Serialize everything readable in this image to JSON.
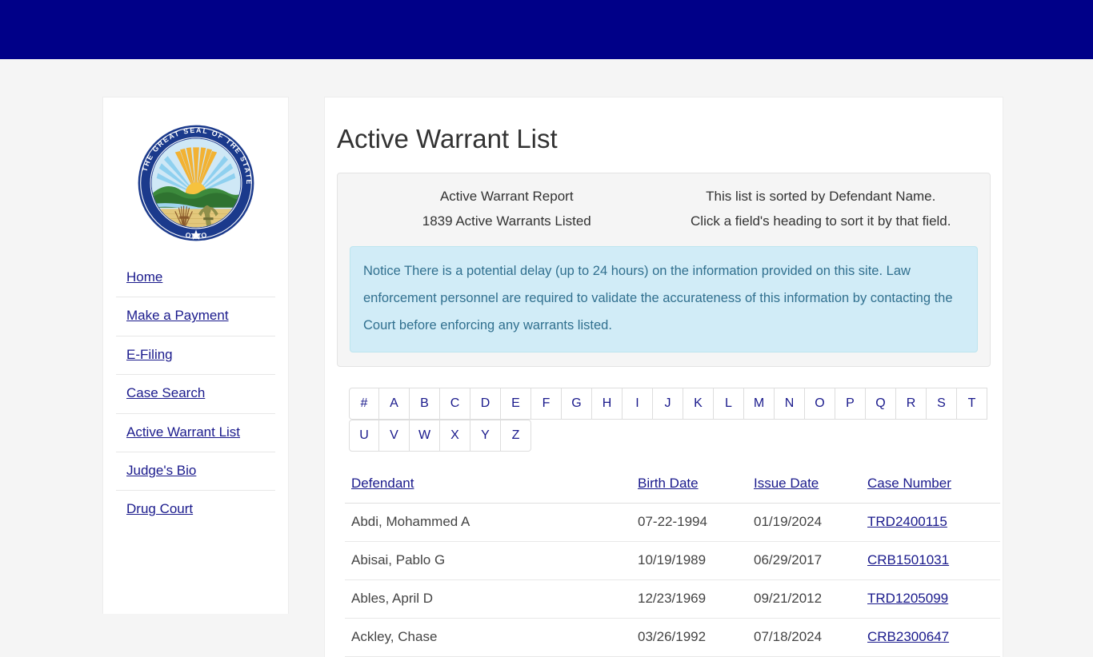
{
  "header": {
    "bar_color": "#000088"
  },
  "sidebar": {
    "seal": {
      "icon": "ohio-state-seal",
      "ring_text_top": "THE GREAT SEAL OF",
      "ring_text_bottom": "THE STATE OF OHIO"
    },
    "items": [
      {
        "label": "Home"
      },
      {
        "label": "Make a Payment"
      },
      {
        "label": "E-Filing"
      },
      {
        "label": "Case Search"
      },
      {
        "label": "Active Warrant List"
      },
      {
        "label": "Judge's Bio"
      },
      {
        "label": "Drug Court"
      }
    ]
  },
  "main": {
    "title": "Active Warrant List",
    "info": {
      "left": [
        "Active Warrant Report",
        "1839 Active Warrants Listed"
      ],
      "right": [
        "This list is sorted by Defendant Name.",
        "Click a field's heading to sort it by that field."
      ],
      "alert": "Notice There is a potential delay (up to 24 hours) on the information provided on this site. Law enforcement personnel are required to validate the accurateness of this information by contacting the Court before enforcing any warrants listed.",
      "alert_bg": "#d1ecf7",
      "alert_text_color": "#31708f"
    },
    "pagination": {
      "row1": [
        "#",
        "A",
        "B",
        "C",
        "D",
        "E",
        "F",
        "G",
        "H",
        "I",
        "J",
        "K",
        "L",
        "M",
        "N",
        "O",
        "P",
        "Q",
        "R",
        "S",
        "T"
      ],
      "row2": [
        "U",
        "V",
        "W",
        "X",
        "Y",
        "Z"
      ]
    },
    "table": {
      "columns": [
        "Defendant",
        "Birth Date",
        "Issue Date",
        "Case Number"
      ],
      "rows": [
        {
          "defendant": "Abdi, Mohammed A",
          "birth_date": "07-22-1994",
          "issue_date": "01/19/2024",
          "case_number": "TRD2400115"
        },
        {
          "defendant": "Abisai, Pablo G",
          "birth_date": "10/19/1989",
          "issue_date": "06/29/2017",
          "case_number": "CRB1501031"
        },
        {
          "defendant": "Ables, April D",
          "birth_date": "12/23/1969",
          "issue_date": "09/21/2012",
          "case_number": "TRD1205099"
        },
        {
          "defendant": "Ackley, Chase",
          "birth_date": "03/26/1992",
          "issue_date": "07/18/2024",
          "case_number": "CRB2300647"
        }
      ]
    }
  }
}
